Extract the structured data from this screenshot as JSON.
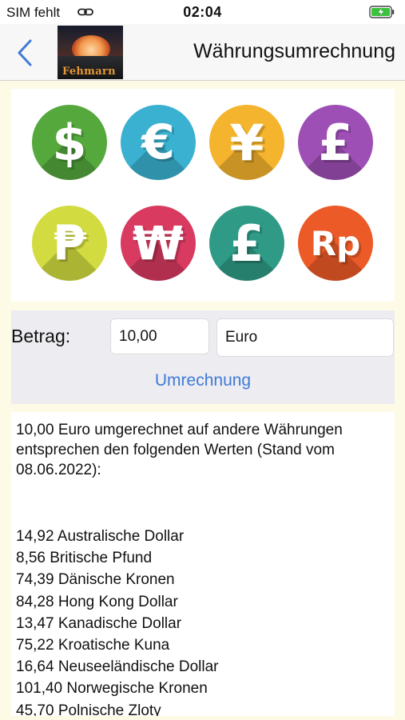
{
  "status_bar": {
    "carrier": "SIM fehlt",
    "time": "02:04",
    "icons": [
      "link-icon",
      "battery-charging-icon"
    ]
  },
  "nav": {
    "back_icon": "chevron-left-icon",
    "logo_text": "Fehmarn",
    "title": "Währungsumrechnung"
  },
  "currency_icons": [
    {
      "symbol": "$",
      "color": "#54a83c"
    },
    {
      "symbol": "€",
      "color": "#3ab1d0"
    },
    {
      "symbol": "¥",
      "color": "#f4b42d"
    },
    {
      "symbol": "£",
      "color": "#9e4fb5"
    },
    {
      "symbol": "₱",
      "color": "#d2dc40"
    },
    {
      "symbol": "₩",
      "color": "#d83a60"
    },
    {
      "symbol": "£",
      "color": "#2f9a85"
    },
    {
      "symbol": "Rp",
      "color": "#eb5a27"
    }
  ],
  "form": {
    "amount_label": "Betrag:",
    "amount_value": "10,00",
    "currency_value": "Euro",
    "convert_label": "Umrechnung"
  },
  "result": {
    "intro": "10,00 Euro umgerechnet auf andere Währungen entsprechen den folgenden Werten (Stand vom 08.06.2022):",
    "rates": [
      "14,92 Australische Dollar",
      "8,56 Britische Pfund",
      "74,39 Dänische Kronen",
      "84,28 Hong Kong Dollar",
      "13,47 Kanadische Dollar",
      "75,22 Kroatische Kuna",
      "16,64 Neuseeländische Dollar",
      "101,40 Norwegische Kronen",
      "45,70 Polnische Zloty"
    ]
  },
  "colors": {
    "content_background": "#fdfbe5",
    "form_background": "#ececf1",
    "accent_blue": "#3f7ad7"
  }
}
